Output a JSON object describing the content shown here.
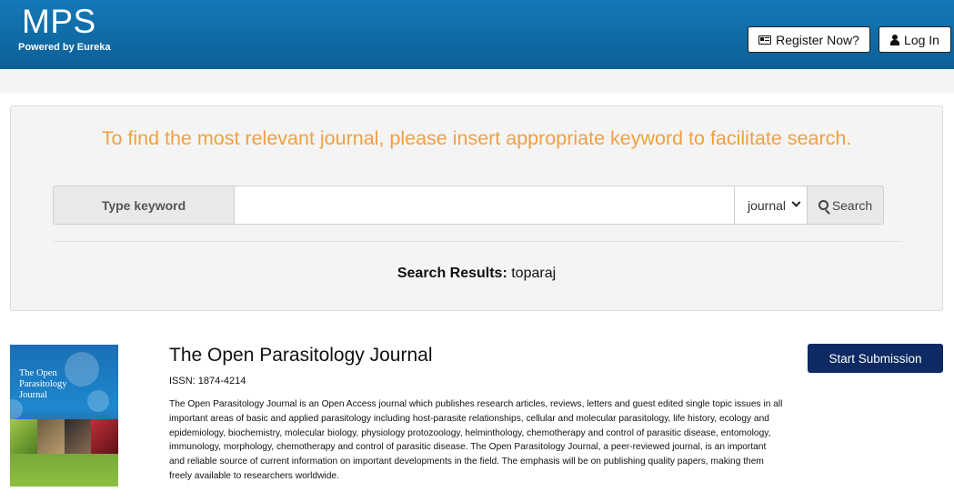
{
  "header": {
    "brand_title": "MPS",
    "brand_subtitle": "Powered by Eureka",
    "register_label": "Register Now?",
    "login_label": "Log In"
  },
  "search": {
    "prompt": "To find the most relevant journal, please insert appropriate keyword to facilitate search.",
    "keyword_label": "Type keyword",
    "input_value": "",
    "input_placeholder": "",
    "type_selected": "journal",
    "search_label": "Search",
    "results_label": "Search Results:",
    "results_query": "toparaj"
  },
  "journal": {
    "title": "The Open Parasitology Journal",
    "issn": "ISSN: 1874-4214",
    "description": "The Open Parasitology Journal is an Open Access journal which publishes research articles, reviews, letters and guest edited single topic issues in all important areas of basic and applied parasitology including host-parasite relationships, cellular and molecular parasitology, life history, ecology and epidemiology, biochemistry, molecular biology, physiology protozoology, helminthology, chemotherapy and control of parasitic disease, entomology, immunology, morphology, chemotherapy and control of parasitic disease. The Open Parasitology Journal, a peer-reviewed journal, is an important and reliable source of current information on important developments in the field. The emphasis will be on publishing quality papers, making them freely available to researchers worldwide.",
    "cover_title": "The Open Parasitology Journal",
    "submit_label": "Start Submission"
  },
  "colors": {
    "header": "#0d5f95",
    "prompt": "#f0a040",
    "submit": "#0e2a63"
  }
}
